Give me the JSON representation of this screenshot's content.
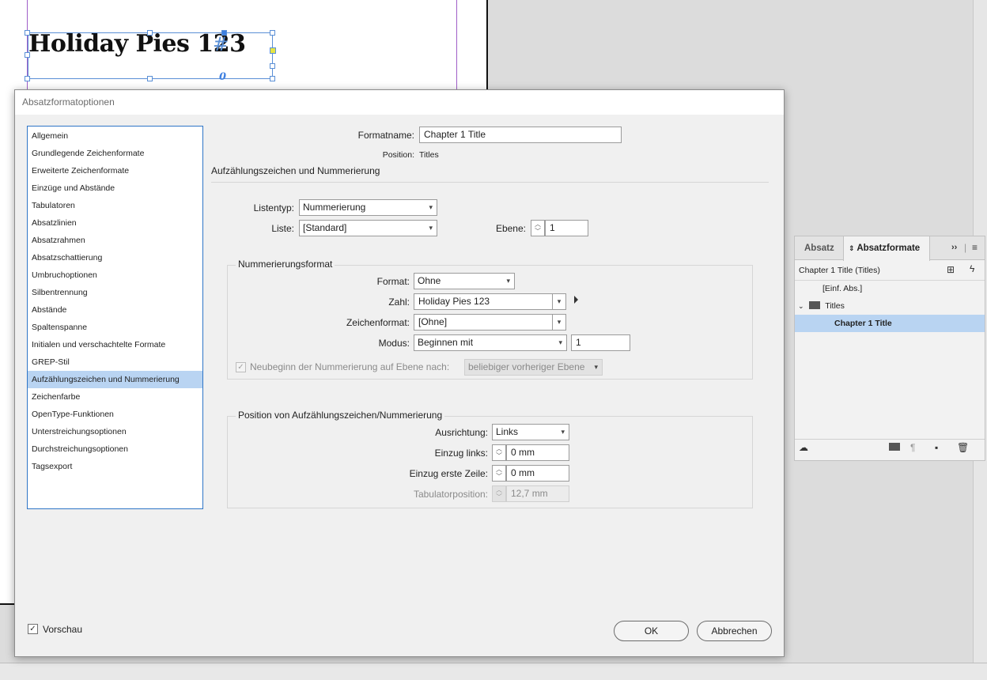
{
  "canvas": {
    "frame_text": "Holiday Pies 123",
    "frame_hash": "#",
    "overset_marker": "0"
  },
  "dialog": {
    "title": "Absatzformatoptionen",
    "categories": [
      "Allgemein",
      "Grundlegende Zeichenformate",
      "Erweiterte Zeichenformate",
      "Einzüge und Abstände",
      "Tabulatoren",
      "Absatzlinien",
      "Absatzrahmen",
      "Absatzschattierung",
      "Umbruchoptionen",
      "Silbentrennung",
      "Abstände",
      "Spaltenspanne",
      "Initialen und verschachtelte Formate",
      "GREP-Stil",
      "Aufzählungszeichen und Nummerierung",
      "Zeichenfarbe",
      "OpenType-Funktionen",
      "Unterstreichungsoptionen",
      "Durchstreichungsoptionen",
      "Tagsexport"
    ],
    "active_category_index": 14,
    "format_name_label": "Formatname:",
    "format_name_value": "Chapter 1 Title",
    "position_label": "Position:",
    "position_value": "Titles",
    "section_heading": "Aufzählungszeichen und Nummerierung",
    "list_type_label": "Listentyp:",
    "list_type_value": "Nummerierung",
    "list_label": "Liste:",
    "list_value": "[Standard]",
    "level_label": "Ebene:",
    "level_value": "1",
    "numbering_group_title": "Nummerierungsformat",
    "format_label": "Format:",
    "format_value": "Ohne",
    "number_label": "Zahl:",
    "number_value": "Holiday Pies 123",
    "char_style_label": "Zeichenformat:",
    "char_style_value": "[Ohne]",
    "mode_label": "Modus:",
    "mode_value": "Beginnen mit",
    "mode_start_value": "1",
    "restart_label": "Neubeginn der Nummerierung auf Ebene nach:",
    "restart_value": "beliebiger vorheriger Ebene",
    "position_group_title": "Position von Aufzählungszeichen/Nummerierung",
    "alignment_label": "Ausrichtung:",
    "alignment_value": "Links",
    "left_indent_label": "Einzug links:",
    "left_indent_value": "0 mm",
    "first_line_label": "Einzug erste Zeile:",
    "first_line_value": "0 mm",
    "tab_position_label": "Tabulatorposition:",
    "tab_position_value": "12,7 mm",
    "preview_label": "Vorschau",
    "ok_label": "OK",
    "cancel_label": "Abbrechen"
  },
  "panel": {
    "tab_absatz": "Absatz",
    "tab_absatzformate": "Absatzformate",
    "current_style": "Chapter 1 Title (Titles)",
    "rows": {
      "basic": "[Einf. Abs.]",
      "group": "Titles",
      "selected": "Chapter 1 Title"
    },
    "expand_glyph": "››",
    "icons": [
      "cloud-icon",
      "folder-icon",
      "clear-overrides-icon",
      "new-style-icon",
      "trash-icon"
    ]
  }
}
